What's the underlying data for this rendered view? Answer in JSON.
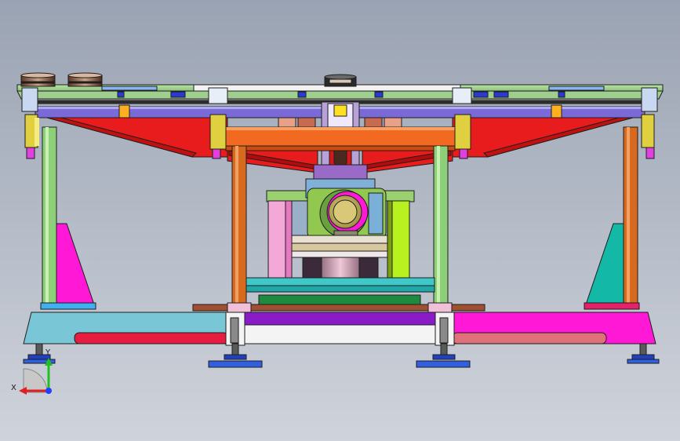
{
  "viewport": {
    "background_top": "#9aa3b3",
    "background_bottom": "#cfd3db"
  },
  "triad": {
    "x_label": "X",
    "y_label": "Y",
    "x_color": "#e02020",
    "y_color": "#20c020",
    "z_color": "#2040ff"
  },
  "palette": {
    "outline": "#1e1e1e",
    "plate_green": "#b7e4a3",
    "red_strut": "#e81c1c",
    "orange_beam": "#f26a21",
    "magenta": "#ff18d6",
    "teal": "#13b8a6",
    "light_blue": "#79c6d6",
    "violet": "#8a1cc8",
    "navy": "#2040c0",
    "olive": "#c8d060"
  }
}
